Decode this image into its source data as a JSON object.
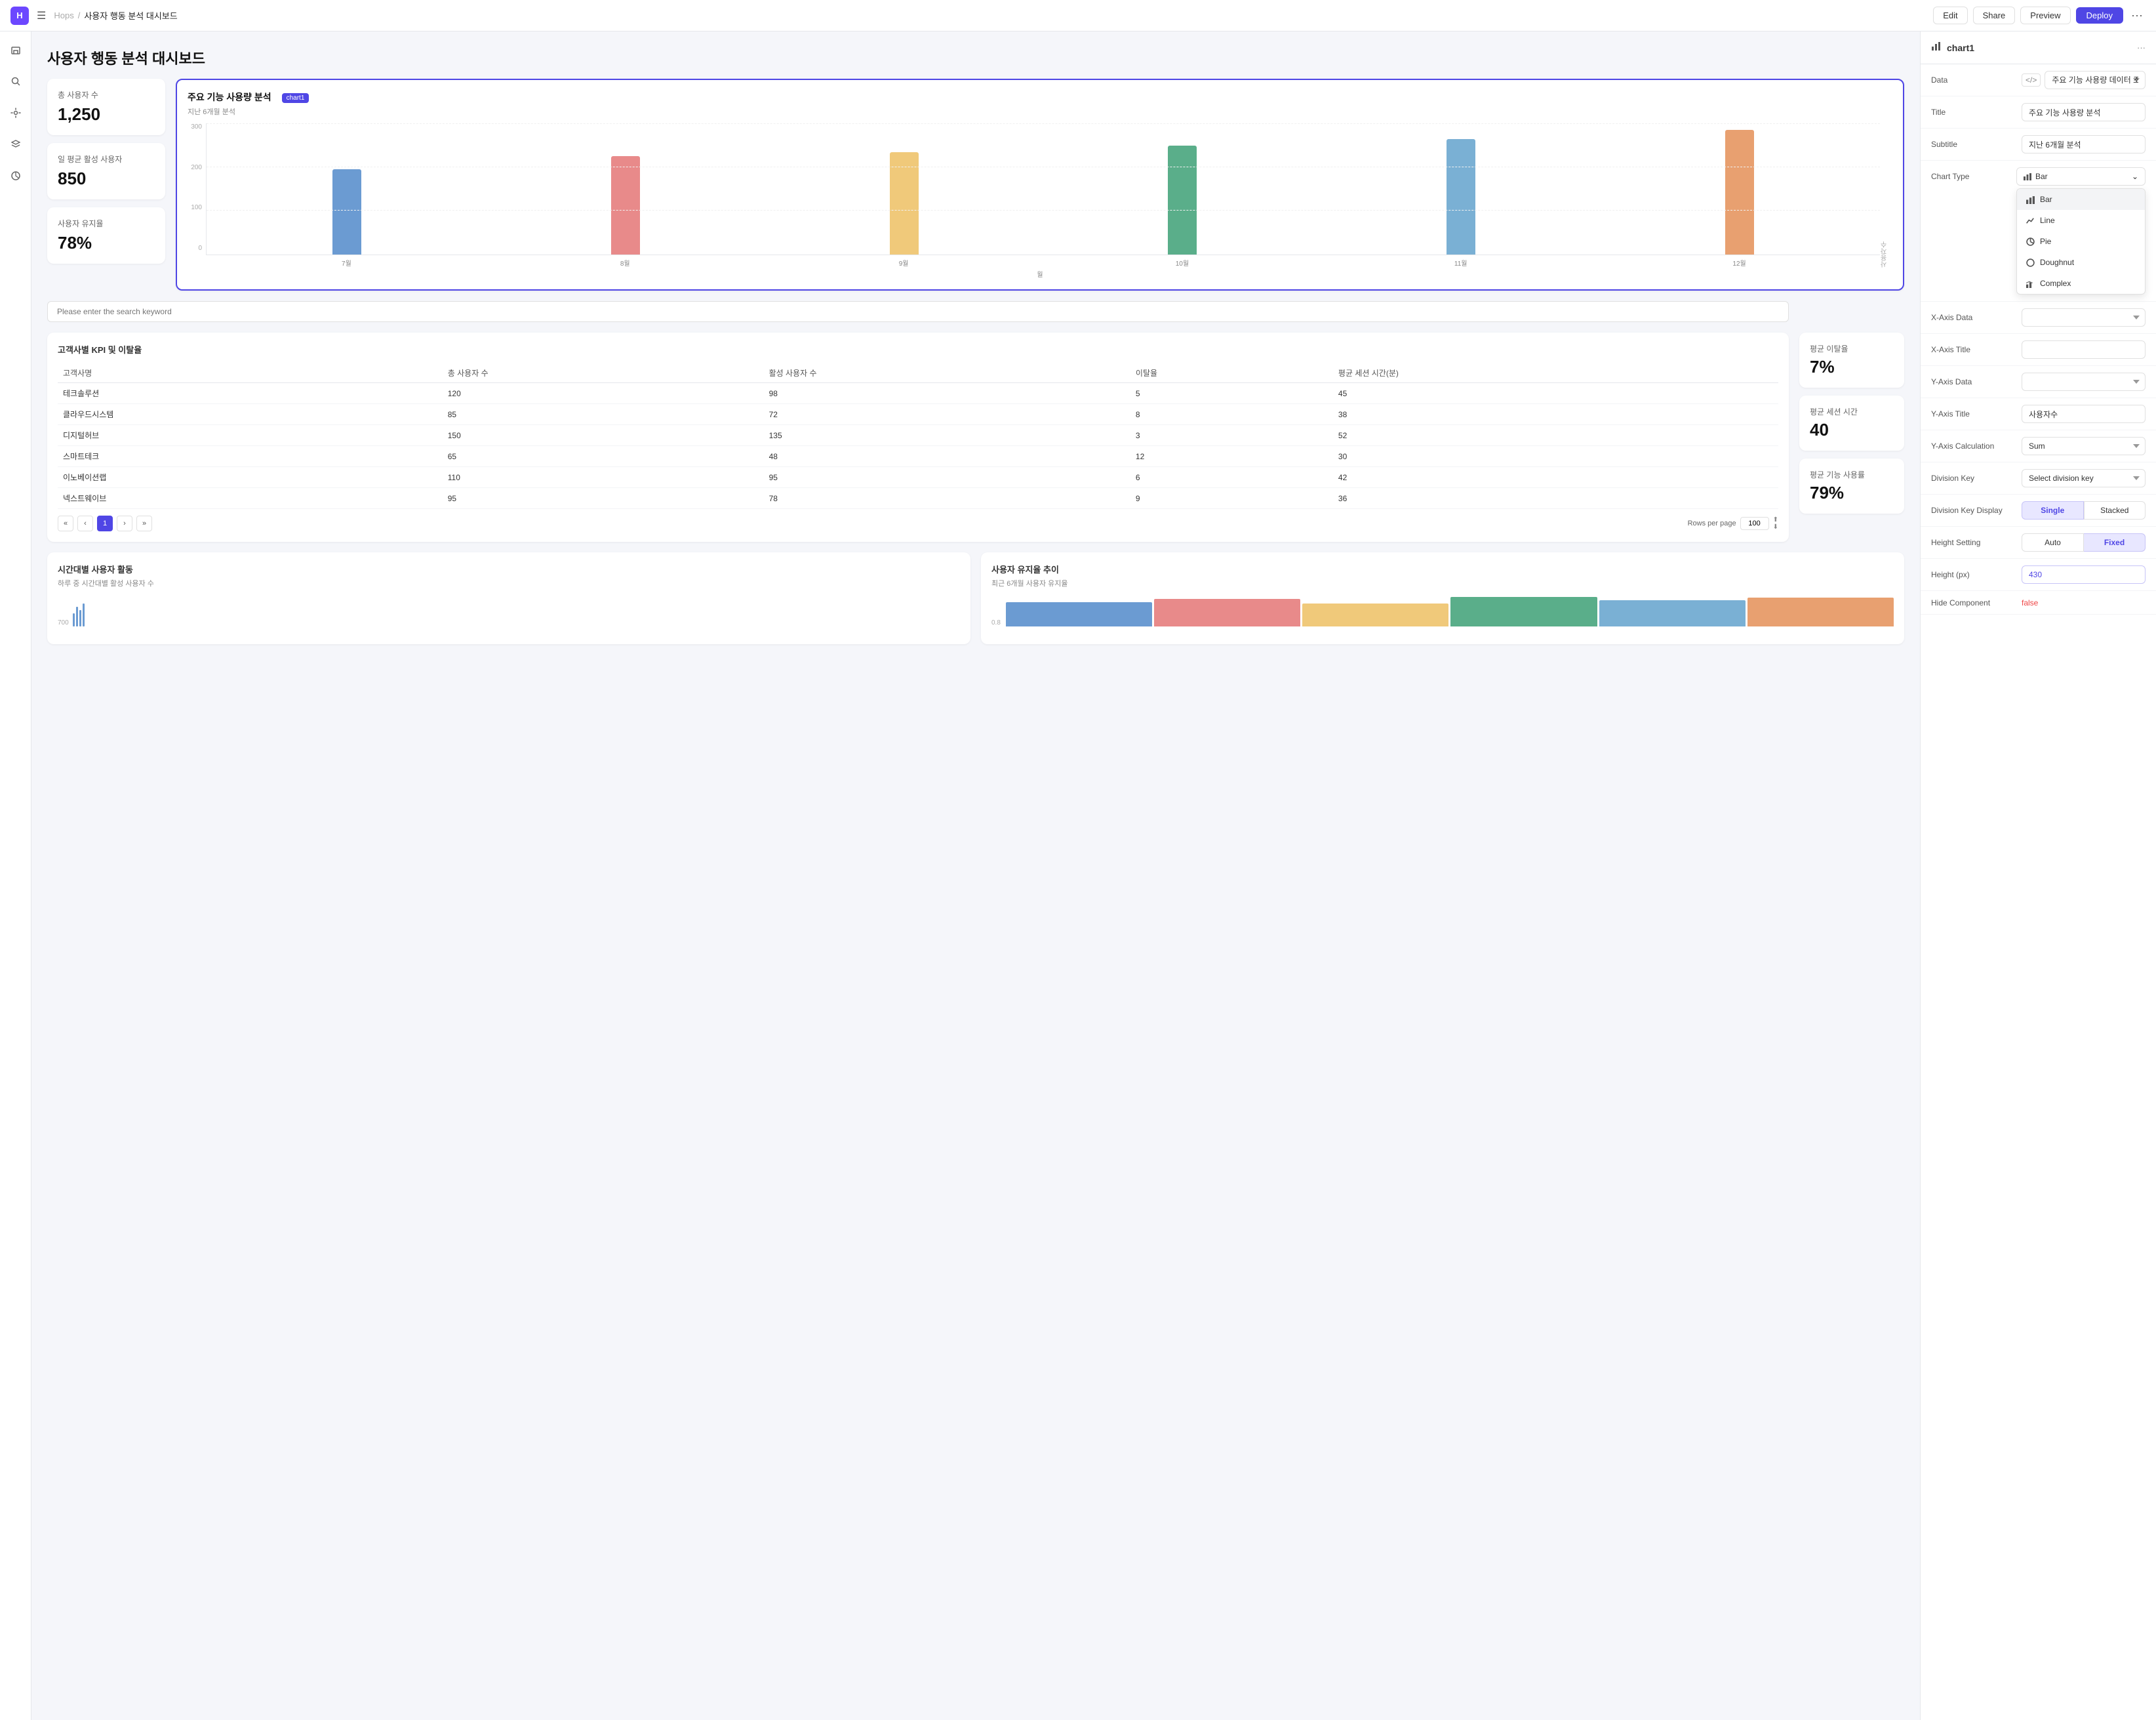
{
  "topnav": {
    "logo_text": "H",
    "app_name": "Hops",
    "separator": "/",
    "page_title": "사용자 행동 분석 대시보드",
    "edit_label": "Edit",
    "share_label": "Share",
    "preview_label": "Preview",
    "deploy_label": "Deploy"
  },
  "kpi_cards": [
    {
      "label": "총 사용자 수",
      "value": "1,250"
    },
    {
      "label": "일 평균 활성 사용자",
      "value": "850"
    },
    {
      "label": "사용자 유지율",
      "value": "78%"
    }
  ],
  "bar_chart": {
    "title": "주요 기능 사용량 분석",
    "subtitle": "지난 6개월 분석",
    "tag": "chart1",
    "y_axis_labels": [
      "300",
      "200",
      "100",
      "0"
    ],
    "x_axis_title": "월",
    "bars": [
      {
        "label": "7월",
        "height_pct": 65,
        "color": "#6b9bd2"
      },
      {
        "label": "8월",
        "height_pct": 75,
        "color": "#e88a8a"
      },
      {
        "label": "9월",
        "height_pct": 78,
        "color": "#f0c97a"
      },
      {
        "label": "10월",
        "height_pct": 83,
        "color": "#5aae8a"
      },
      {
        "label": "11월",
        "height_pct": 88,
        "color": "#7ab0d4"
      },
      {
        "label": "12월",
        "height_pct": 95,
        "color": "#e8a070"
      }
    ]
  },
  "search_placeholder": "Please enter the search keyword",
  "customer_table": {
    "title": "고객사별 KPI 및 이탈율",
    "columns": [
      "고객사명",
      "총 사용자 수",
      "활성 사용자 수",
      "이탈율",
      "평균 세션 시간(분)"
    ],
    "rows": [
      {
        "name": "테크솔루션",
        "total": "120",
        "active": "98",
        "churn": "5",
        "session": "45"
      },
      {
        "name": "클라우드시스템",
        "total": "85",
        "active": "72",
        "churn": "8",
        "session": "38"
      },
      {
        "name": "디지털허브",
        "total": "150",
        "active": "135",
        "churn": "3",
        "session": "52"
      },
      {
        "name": "스마트테크",
        "total": "65",
        "active": "48",
        "churn": "12",
        "session": "30"
      },
      {
        "name": "이노베이션랩",
        "total": "110",
        "active": "95",
        "churn": "6",
        "session": "42"
      },
      {
        "name": "넥스트웨이브",
        "total": "95",
        "active": "78",
        "churn": "9",
        "session": "36"
      }
    ],
    "page": "1",
    "rows_per_page_label": "Rows per page",
    "rows_per_page_value": "100"
  },
  "stat_cards": [
    {
      "label": "평균 이탈율",
      "value": "7%"
    },
    {
      "label": "평균 세션 시간",
      "value": "40"
    },
    {
      "label": "평균 기능 사용률",
      "value": "79%"
    }
  ],
  "bottom_cards": [
    {
      "title": "시간대별 사용자 활동",
      "subtitle": "하루 중 시간대별 활성 사용자 수",
      "y_label": "700"
    },
    {
      "title": "사용자 유지율 추이",
      "subtitle": "최근 6개월 사용자 유지율",
      "y_label": "0.8"
    }
  ],
  "right_panel": {
    "chart_title": "chart1",
    "data_label": "Data",
    "data_code_icon": "</>",
    "data_value": "주요 기능 사용량 데이터 조회",
    "title_label": "Title",
    "title_value": "주요 기능 사용량 분석",
    "subtitle_label": "Subtitle",
    "subtitle_value": "지난 6개월 분석",
    "chart_type_label": "Chart Type",
    "chart_type_value": "Bar",
    "chart_type_options": [
      {
        "label": "Bar",
        "icon": "bar"
      },
      {
        "label": "Line",
        "icon": "line"
      },
      {
        "label": "Pie",
        "icon": "pie"
      },
      {
        "label": "Doughnut",
        "icon": "doughnut"
      },
      {
        "label": "Complex",
        "icon": "complex"
      }
    ],
    "xaxis_data_label": "X-Axis Data",
    "xaxis_title_label": "X-Axis Title",
    "yaxis_data_label": "Y-Axis Data",
    "yaxis_title_label": "Y-Axis Title",
    "yaxis_title_value": "사용자수",
    "yaxis_calc_label": "Y-Axis Calculation",
    "yaxis_calc_value": "Sum",
    "division_key_label": "Division Key",
    "division_key_value": "Select division key",
    "division_key_display_label": "Division Key Display",
    "division_key_single": "Single",
    "division_key_stacked": "Stacked",
    "height_setting_label": "Height Setting",
    "height_auto": "Auto",
    "height_fixed": "Fixed",
    "height_px_label": "Height (px)",
    "height_px_value": "430",
    "hide_component_label": "Hide Component",
    "hide_component_value": "false"
  }
}
